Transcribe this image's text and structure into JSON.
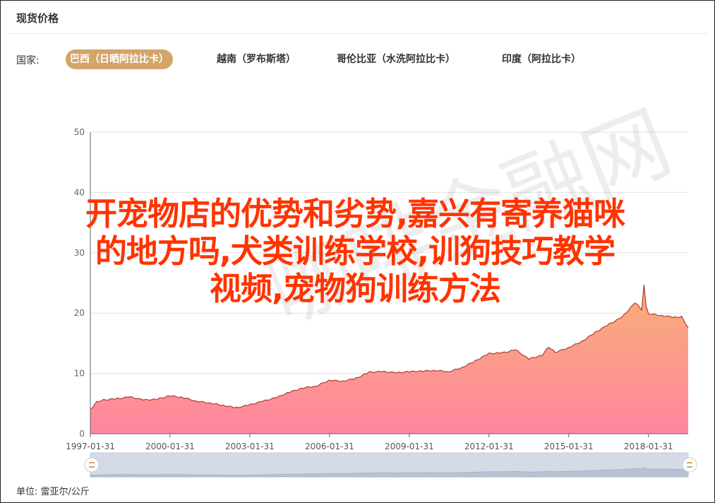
{
  "panel": {
    "title": "现货价格",
    "country_label": "国家:",
    "unit_text": "单位: 雷亚尔/公斤"
  },
  "tabs": [
    {
      "label": "巴西（日晒阿拉比卡）",
      "active": true
    },
    {
      "label": "越南（罗布斯塔）",
      "active": false
    },
    {
      "label": "哥伦比亚（水洗阿拉比卡）",
      "active": false
    },
    {
      "label": "印度（阿拉比卡）",
      "active": false
    }
  ],
  "overlay": {
    "lines": [
      "开宠物店的优势和劣势,嘉兴有寄养猫咪",
      "的地方吗,犬类训练学校,训狗技巧教学",
      "视频,宠物狗训练方法"
    ],
    "color": "#ff3300"
  },
  "watermark": "咖啡金融网",
  "colors": {
    "accent": "#d4a46a",
    "area_top": "#f8b077",
    "area_bottom": "#ff85a0",
    "line": "#b03a3a"
  },
  "chart_data": {
    "type": "area",
    "title": "现货价格",
    "xlabel": "",
    "ylabel": "",
    "ylim": [
      0,
      50
    ],
    "yticks": [
      "0",
      "10",
      "20",
      "30",
      "40",
      "50"
    ],
    "xticks": [
      "1997-01-31",
      "2000-01-31",
      "2003-01-31",
      "2006-01-31",
      "2009-01-31",
      "2012-01-31",
      "2015-01-31",
      "2018-01-31"
    ],
    "grid": true,
    "series": [
      {
        "x": [
          "1997-01-31",
          "1997-04-30",
          "1997-07-31",
          "1998-01-31",
          "1998-07-31",
          "1999-01-31",
          "1999-07-31",
          "2000-01-31",
          "2000-07-31",
          "2001-01-31",
          "2001-07-31",
          "2002-01-31",
          "2002-07-31",
          "2003-01-31",
          "2003-07-31",
          "2004-01-31",
          "2004-07-31",
          "2005-01-31",
          "2005-07-31",
          "2006-01-31",
          "2006-07-31",
          "2007-01-31",
          "2007-07-31",
          "2008-01-31",
          "2008-07-31",
          "2009-01-31",
          "2009-07-31",
          "2010-01-31",
          "2010-07-31",
          "2011-01-31",
          "2011-07-31",
          "2012-01-31",
          "2012-07-31",
          "2013-01-31",
          "2013-07-31",
          "2014-01-31",
          "2014-04-30",
          "2014-07-31",
          "2015-01-31",
          "2015-07-31",
          "2016-01-31",
          "2016-07-31",
          "2017-01-31",
          "2017-07-31",
          "2017-10-31",
          "2017-11-30",
          "2017-12-31",
          "2018-01-31",
          "2018-07-31",
          "2019-01-31",
          "2019-04-30",
          "2019-07-31"
        ],
        "values": [
          4.0,
          5.3,
          5.6,
          5.8,
          6.1,
          5.6,
          5.7,
          6.3,
          6.0,
          5.4,
          5.1,
          4.7,
          4.3,
          4.8,
          5.4,
          6.0,
          6.9,
          7.6,
          7.9,
          8.9,
          8.7,
          9.2,
          10.2,
          10.3,
          10.1,
          10.3,
          10.4,
          10.5,
          10.3,
          11.0,
          12.1,
          13.3,
          13.4,
          13.9,
          12.4,
          13.0,
          14.4,
          13.5,
          14.3,
          15.3,
          16.8,
          18.1,
          19.3,
          21.7,
          20.6,
          24.8,
          21.2,
          19.9,
          19.6,
          19.3,
          19.4,
          17.6
        ]
      }
    ]
  }
}
